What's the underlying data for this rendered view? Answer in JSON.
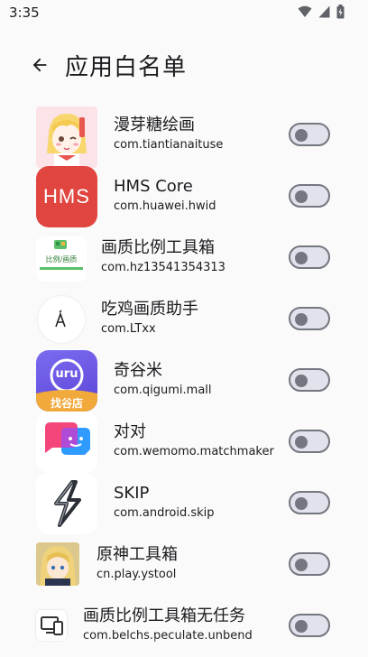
{
  "status_bar": {
    "time": "3:35",
    "icons": [
      "wifi-icon",
      "cellular-icon",
      "battery-icon"
    ]
  },
  "app_bar": {
    "back_icon": "arrow-back-icon",
    "title": "应用白名单"
  },
  "colors": {
    "background": "#fafafa",
    "switch_off_track": "#e1e2ec",
    "switch_off_border": "#74777f",
    "text": "#1c1b1f"
  },
  "apps": [
    {
      "name": "漫芽糖绘画",
      "package": "com.tiantianaituse",
      "enabled": false
    },
    {
      "name": "HMS Core",
      "package": "com.huawei.hwid",
      "enabled": false,
      "icon_text": "HMS"
    },
    {
      "name": "画质比例工具箱",
      "package": "com.hz13541354313",
      "enabled": false,
      "icon_text": "比例/画质"
    },
    {
      "name": "吃鸡画质助手",
      "package": "com.LTxx",
      "enabled": false
    },
    {
      "name": "奇谷米",
      "package": "com.qigumi.mall",
      "enabled": false,
      "icon_text": "uru",
      "icon_badge": "找谷店"
    },
    {
      "name": "对对",
      "package": "com.wemomo.matchmaker",
      "enabled": false
    },
    {
      "name": "SKIP",
      "package": "com.android.skip",
      "enabled": false
    },
    {
      "name": "原神工具箱",
      "package": "cn.play.ystool",
      "enabled": false
    },
    {
      "name": "画质比例工具箱无任务",
      "package": "com.belchs.peculate.unbend",
      "enabled": false
    }
  ]
}
